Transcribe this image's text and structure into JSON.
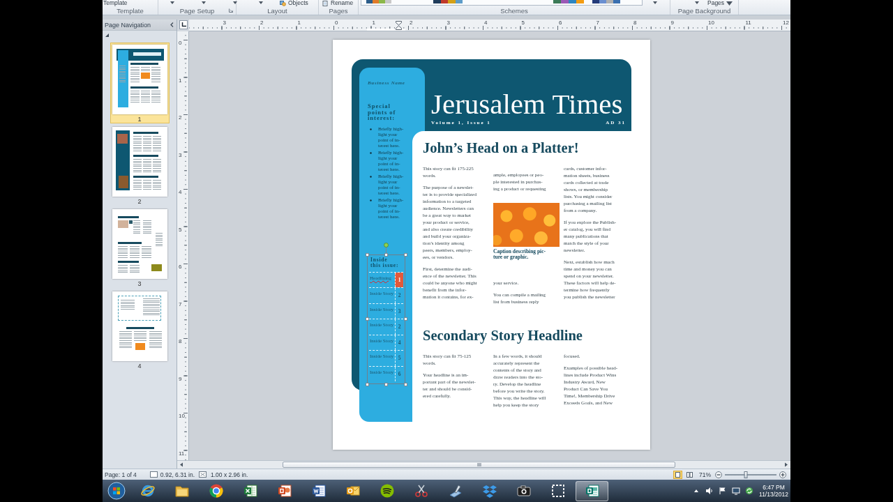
{
  "ribbon": {
    "groups": [
      {
        "label": "Template",
        "launcher": false,
        "items": [
          {
            "kind": "text-button",
            "label": "Template"
          }
        ]
      },
      {
        "label": "Page Setup",
        "launcher": true,
        "items": [
          {
            "kind": "caret"
          },
          {
            "kind": "caret"
          },
          {
            "kind": "caret"
          }
        ]
      },
      {
        "label": "Layout",
        "launcher": false,
        "items": [
          {
            "kind": "caret"
          },
          {
            "kind": "icon-button",
            "label": "Objects"
          }
        ]
      },
      {
        "label": "Pages",
        "launcher": false,
        "items": [
          {
            "kind": "icon-button",
            "label": "Rename"
          }
        ]
      },
      {
        "label": "Schemes",
        "launcher": false,
        "items": [
          {
            "kind": "gallery"
          },
          {
            "kind": "caret"
          }
        ]
      },
      {
        "label": "Page Background",
        "launcher": false,
        "items": [
          {
            "kind": "caret"
          },
          {
            "kind": "dropdown",
            "label": "Pages"
          }
        ]
      }
    ]
  },
  "page_navigation": {
    "title": "Page Navigation",
    "pages": [
      {
        "number": "1",
        "selected": true
      },
      {
        "number": "2",
        "selected": false
      },
      {
        "number": "3",
        "selected": false
      },
      {
        "number": "4",
        "selected": false
      }
    ]
  },
  "rulers": {
    "horizontal": [
      "3",
      "2",
      "1",
      "0",
      "1",
      "2",
      "3",
      "4",
      "5",
      "6",
      "7",
      "8",
      "9",
      "10",
      "11",
      "12"
    ],
    "vertical": [
      "0",
      "1",
      "2",
      "3",
      "4",
      "5",
      "6",
      "7",
      "8",
      "9",
      "10",
      "11"
    ]
  },
  "newsletter": {
    "business_name": "Business Name",
    "title": "Jerusalem Times",
    "volume": "Volume 1, Issue 1",
    "date": "AD 31",
    "sidebar": {
      "heading": "Special\npoints of\ninterest:",
      "bullets": [
        "Briefly high-\nlight your\npoint of in-\nterest here.",
        "Briefly high-\nlight your\npoint of in-\nterest here.",
        "Briefly high-\nlight your\npoint of in-\nterest here.",
        "Briefly high-\nlight your\npoint of in-\nterest here."
      ],
      "inside_issue": {
        "heading": "Inside\nthis issue:",
        "selected": true,
        "rows": [
          {
            "story": "Headlining",
            "page": "1",
            "selected": true,
            "misspelled": true
          },
          {
            "story": "Inside Story",
            "page": "2",
            "selected": false,
            "misspelled": false
          },
          {
            "story": "Inside Story",
            "page": "3",
            "selected": false,
            "misspelled": false
          },
          {
            "story": "Inside Story",
            "page": "2",
            "selected": false,
            "misspelled": false
          },
          {
            "story": "Inside Story",
            "page": "4",
            "selected": false,
            "misspelled": false
          },
          {
            "story": "Inside Story",
            "page": "5",
            "selected": false,
            "misspelled": false
          },
          {
            "story": "Inside Story",
            "page": "6",
            "selected": false,
            "misspelled": false
          }
        ]
      }
    },
    "stories": [
      {
        "headline": "John’s Head on a Platter!",
        "columns": [
          [
            {
              "kind": "text",
              "text": "This story can fit 175-225\nwords."
            },
            {
              "kind": "text",
              "text": "The purpose of a newslet-\nter is to provide specialized\ninformation to a targeted\naudience. Newsletters can\nbe a great way to market\nyour product or service,\nand also create credibility\nand build your organiza-\ntion’s identity among\npeers, members, employ-\nees, or vendors."
            },
            {
              "kind": "text",
              "text": "First, determine the audi-\nence of the newsletter. This\ncould be anyone who might\nbenefit from the infor-\nmation it contains, for ex-"
            }
          ],
          [
            {
              "kind": "text",
              "text": "ample, employees or peo-\nple interested in purchas-\ning a product or requesting"
            },
            {
              "kind": "photo"
            },
            {
              "kind": "caption",
              "text": "Caption describing pic-\nture or graphic."
            },
            {
              "kind": "text",
              "text": "your service."
            },
            {
              "kind": "text",
              "text": "You can compile a mailing\nlist from business reply"
            }
          ],
          [
            {
              "kind": "text",
              "text": "cards, customer infor-\nmation sheets, business\ncards collected at trade\nshows, or membership\nlists. You might consider\npurchasing a mailing list\nfrom a company."
            },
            {
              "kind": "text",
              "text": "If you explore the Publish-\ner catalog, you will find\nmany publications that\nmatch the style of your\nnewsletter."
            },
            {
              "kind": "text",
              "text": "Next, establish how much\ntime and money you can\nspend on your newsletter.\nThese factors will help de-\ntermine how frequently\nyou publish the newsletter"
            }
          ]
        ]
      },
      {
        "headline": "Secondary Story Headline",
        "columns": [
          [
            {
              "kind": "text",
              "text": "This story can fit 75-125\nwords."
            },
            {
              "kind": "text",
              "text": "Your headline is an im-\nportant part of the newslet-\nter and should be consid-\nered carefully."
            }
          ],
          [
            {
              "kind": "text",
              "text": "In a few words, it should\naccurately represent the\ncontents of the story and\ndraw readers into the sto-\nry. Develop the headline\nbefore you write the story.\nThis way, the headline will\nhelp you keep the story"
            }
          ],
          [
            {
              "kind": "text",
              "text": "focused."
            },
            {
              "kind": "text",
              "text": "Examples of possible head-\nlines include Product Wins\nIndustry Award, New\nProduct Can Save You\nTime!, Membership Drive\nExceeds Goals, and New"
            }
          ]
        ]
      }
    ]
  },
  "status_bar": {
    "page": "Page: 1 of 4",
    "position": "0.92, 6.31 in.",
    "size": "1.00 x 2.96 in.",
    "views": [
      {
        "selected": true
      },
      {
        "selected": false
      }
    ],
    "zoom": {
      "value": "71%",
      "level": 0.4
    }
  },
  "taskbar": {
    "apps": [
      {
        "kind": "browser-e",
        "active": false
      },
      {
        "kind": "folder",
        "active": false
      },
      {
        "kind": "browser-round",
        "active": false
      },
      {
        "kind": "sheet",
        "active": false
      },
      {
        "kind": "slides",
        "active": false
      },
      {
        "kind": "doc",
        "active": false
      },
      {
        "kind": "mail",
        "active": false
      },
      {
        "kind": "music",
        "active": false
      },
      {
        "kind": "scissors",
        "active": false
      },
      {
        "kind": "pen",
        "active": false
      },
      {
        "kind": "boxes",
        "active": false
      },
      {
        "kind": "camera",
        "active": false
      },
      {
        "kind": "snip",
        "active": false
      },
      {
        "kind": "publisher",
        "active": true
      }
    ],
    "clock": {
      "time": "6:47 PM",
      "date": "11/13/2012"
    }
  }
}
